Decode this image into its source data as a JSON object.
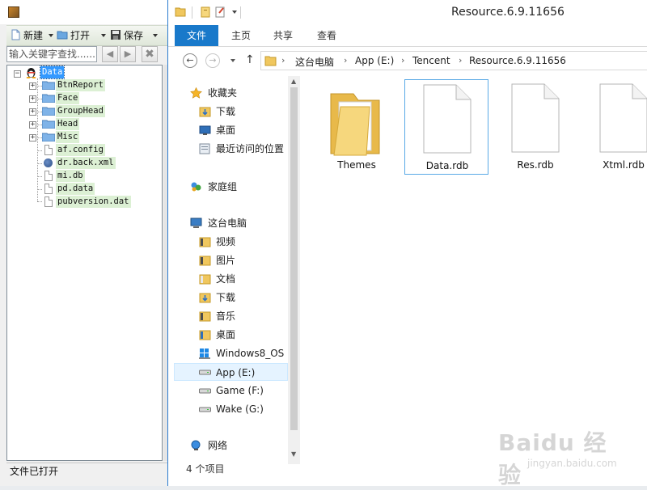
{
  "editor": {
    "toolbar": {
      "new_label": "新建",
      "open_label": "打开",
      "save_label": "保存"
    },
    "search": {
      "placeholder": "输入关键字查找......"
    },
    "tree": {
      "root": "Data",
      "folders": [
        "BtnReport",
        "Face",
        "GroupHead",
        "Head",
        "Misc"
      ],
      "files": [
        "af.config",
        "dr.back.xml",
        "mi.db",
        "pd.data",
        "pubversion.dat"
      ]
    },
    "status": "文件已打开"
  },
  "explorer": {
    "title": "Resource.6.9.11656",
    "tabs": [
      "文件",
      "主页",
      "共享",
      "查看"
    ],
    "breadcrumb": [
      "这台电脑",
      "App (E:)",
      "Tencent",
      "Resource.6.9.11656"
    ],
    "nav": {
      "favorites": "收藏夹",
      "downloads": "下载",
      "desktop": "桌面",
      "recent": "最近访问的位置",
      "homegroup": "家庭组",
      "this_pc": "这台电脑",
      "videos": "视频",
      "pictures": "图片",
      "documents": "文档",
      "downloads2": "下载",
      "music": "音乐",
      "desktop2": "桌面",
      "drive_c": "Windows8_OS (",
      "drive_e": "App (E:)",
      "drive_f": "Game (F:)",
      "drive_g": "Wake (G:)",
      "network": "网络"
    },
    "items": [
      "Themes",
      "Data.rdb",
      "Res.rdb",
      "Xtml.rdb"
    ],
    "status": "4 个项目"
  },
  "watermark": {
    "main": "Baidu 经验",
    "sub": "jingyan.baidu.com"
  },
  "colors": {
    "accent": "#1979ca",
    "tree_highlight": "#dcf0d4",
    "selection": "#3399ff"
  }
}
